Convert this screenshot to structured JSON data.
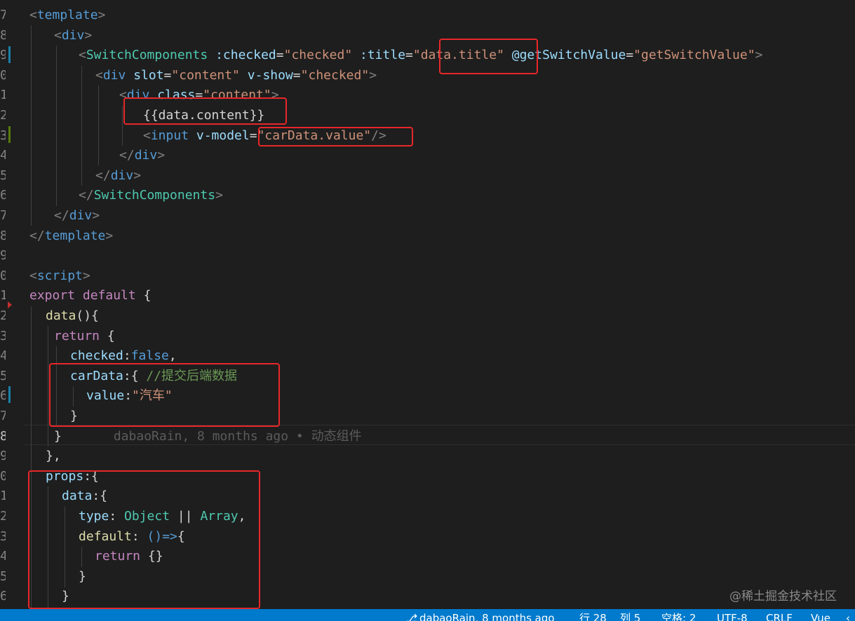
{
  "gutter": {
    "line_numbers": [
      "7",
      "8",
      "9",
      "0",
      "1",
      "2",
      "3",
      "4",
      "5",
      "6",
      "7",
      "8",
      "9",
      "0",
      "1",
      "2",
      "3",
      "4",
      "5",
      "6",
      "7",
      "8",
      "9",
      "0",
      "1",
      "2",
      "3",
      "4",
      "5",
      "6"
    ]
  },
  "code": {
    "l1": {
      "p1": "<",
      "p2": "template",
      "p3": ">"
    },
    "l2": {
      "p1": "<",
      "p2": "div",
      "p3": ">"
    },
    "l3": {
      "p1": "<",
      "p2": "SwitchComponents",
      "p3": " :checked",
      "p4": "=",
      "p5": "\"checked\"",
      "p6": " :title",
      "p7": "=",
      "p8": "\"data.title\"",
      "p9": " @getSwitchValue",
      "p10": "=",
      "p11": "\"getSwitchValue\"",
      "p12": ">"
    },
    "l4": {
      "p1": "<",
      "p2": "div",
      "p3": " slot",
      "p4": "=",
      "p5": "\"content\"",
      "p6": " v-show",
      "p7": "=",
      "p8": "\"checked\"",
      "p9": ">"
    },
    "l5": {
      "p1": "<",
      "p2": "div",
      "p3": " class",
      "p4": "=",
      "p5": "\"content\"",
      "p6": ">"
    },
    "l6": {
      "p1": "{{data.content}}"
    },
    "l7": {
      "p1": "<",
      "p2": "input",
      "p3": " v-model",
      "p4": "=",
      "p5": "\"carData.value\"",
      "p6": "/>"
    },
    "l8": {
      "p1": "</",
      "p2": "div",
      "p3": ">"
    },
    "l9": {
      "p1": "</",
      "p2": "div",
      "p3": ">"
    },
    "l10": {
      "p1": "</",
      "p2": "SwitchComponents",
      "p3": ">"
    },
    "l11": {
      "p1": "</",
      "p2": "div",
      "p3": ">"
    },
    "l12": {
      "p1": "</",
      "p2": "template",
      "p3": ">"
    },
    "l14": {
      "p1": "<",
      "p2": "script",
      "p3": ">"
    },
    "l15": {
      "p1": "export",
      "p2": " default",
      "p3": " {"
    },
    "l16": {
      "p1": "data",
      "p2": "(){"
    },
    "l17": {
      "p1": "return",
      "p2": " {"
    },
    "l18": {
      "p1": "checked",
      "p2": ":",
      "p3": "false",
      "p4": ","
    },
    "l19": {
      "p1": "carData",
      "p2": ":{ ",
      "p3": "//提交后端数据"
    },
    "l20": {
      "p1": "value",
      "p2": ":",
      "p3": "\"汽车\""
    },
    "l21": {
      "p1": "}"
    },
    "l22": {
      "p1": "}",
      "blame": "dabaoRain, 8 months ago • 动态组件"
    },
    "l23": {
      "p1": "},"
    },
    "l24": {
      "p1": "props",
      "p2": ":{"
    },
    "l25": {
      "p1": "data",
      "p2": ":{"
    },
    "l26": {
      "p1": "type",
      "p2": ": ",
      "p3": "Object",
      "p4": " || ",
      "p5": "Array",
      "p6": ","
    },
    "l27": {
      "p1": "default",
      "p2": ": ",
      "p3": "()=>",
      "p4": "{"
    },
    "l28": {
      "p1": "return",
      "p2": " {}"
    },
    "l29": {
      "p1": "}"
    },
    "l30": {
      "p1": "}"
    }
  },
  "watermark": "@稀土掘金技术社区",
  "statusbar": {
    "branch_icon": "git-branch-icon",
    "blame": "dabaoRain, 8 months ago",
    "line": "行 28",
    "col": "列 5",
    "spaces": "空格: 2",
    "encoding": "UTF-8",
    "eol": "CRLF",
    "language": "Vue",
    "feedback_icon": "chevron-icon"
  },
  "colors": {
    "background": "#1e1e1e",
    "highlight_box": "#e8272a",
    "statusbar": "#007acc",
    "tag": "#569cd6",
    "attribute": "#9cdcfe",
    "string": "#ce9178",
    "comment": "#6a9955",
    "keyword": "#c586c0",
    "type": "#4ec9b0"
  }
}
